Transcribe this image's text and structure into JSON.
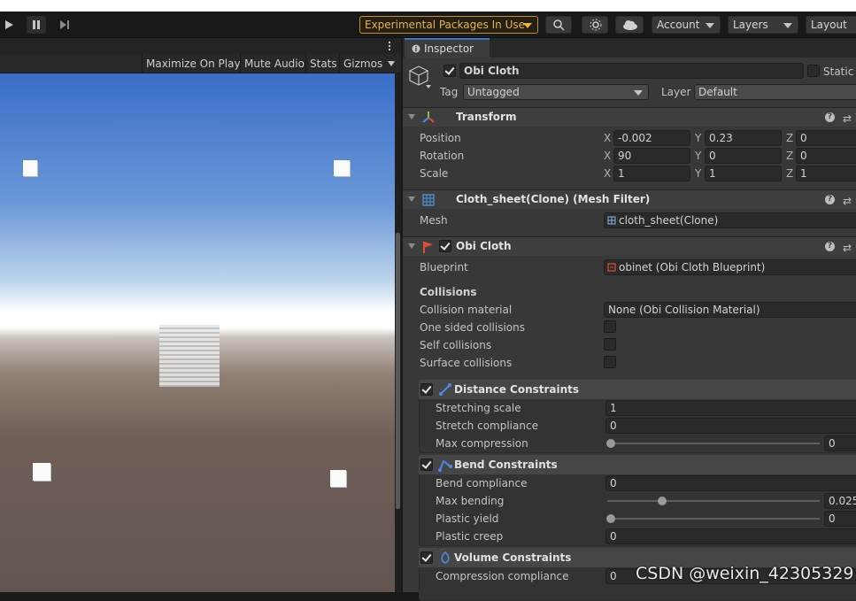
{
  "toolbar": {
    "experimental": "Experimental Packages In Use",
    "account": "Account",
    "layers": "Layers",
    "layout": "Layout"
  },
  "gameview": {
    "maximize": "Maximize On Play",
    "mute": "Mute Audio",
    "stats": "Stats",
    "gizmos": "Gizmos"
  },
  "inspector": {
    "tab": "Inspector",
    "object_name": "Obi Cloth",
    "static_label": "Static",
    "tag_label": "Tag",
    "tag_value": "Untagged",
    "layer_label": "Layer",
    "layer_value": "Default"
  },
  "transform": {
    "title": "Transform",
    "position_label": "Position",
    "rotation_label": "Rotation",
    "scale_label": "Scale",
    "position": {
      "x": "-0.002",
      "y": "0.23",
      "z": "0"
    },
    "rotation": {
      "x": "90",
      "y": "0",
      "z": "0"
    },
    "scale": {
      "x": "1",
      "y": "1",
      "z": "1"
    }
  },
  "mesh_filter": {
    "title": "Cloth_sheet(Clone) (Mesh Filter)",
    "mesh_label": "Mesh",
    "mesh_value": "cloth_sheet(Clone)"
  },
  "obi_cloth": {
    "title": "Obi Cloth",
    "blueprint_label": "Blueprint",
    "blueprint_value": "obinet (Obi Cloth Blueprint)",
    "collisions_header": "Collisions",
    "collision_material_label": "Collision material",
    "collision_material_value": "None (Obi Collision Material)",
    "one_sided_label": "One sided collisions",
    "self_collisions_label": "Self collisions",
    "surface_collisions_label": "Surface collisions"
  },
  "distance": {
    "title": "Distance Constraints",
    "stretching_scale_label": "Stretching scale",
    "stretching_scale_value": "1",
    "stretch_compliance_label": "Stretch compliance",
    "stretch_compliance_value": "0",
    "max_compression_label": "Max compression",
    "max_compression_value": "0"
  },
  "bend": {
    "title": "Bend Constraints",
    "bend_compliance_label": "Bend compliance",
    "bend_compliance_value": "0",
    "max_bending_label": "Max bending",
    "max_bending_value": "0.025",
    "plastic_yield_label": "Plastic yield",
    "plastic_yield_value": "0",
    "plastic_creep_label": "Plastic creep",
    "plastic_creep_value": "0"
  },
  "volume": {
    "title": "Volume Constraints",
    "compression_compliance_label": "Compression compliance",
    "compression_compliance_value": "0"
  },
  "watermark": "CSDN @weixin_42305329",
  "colors": {
    "accent_orange": "#f0b33b",
    "panel_bg": "#383838",
    "field_bg": "#2a2a2a"
  }
}
